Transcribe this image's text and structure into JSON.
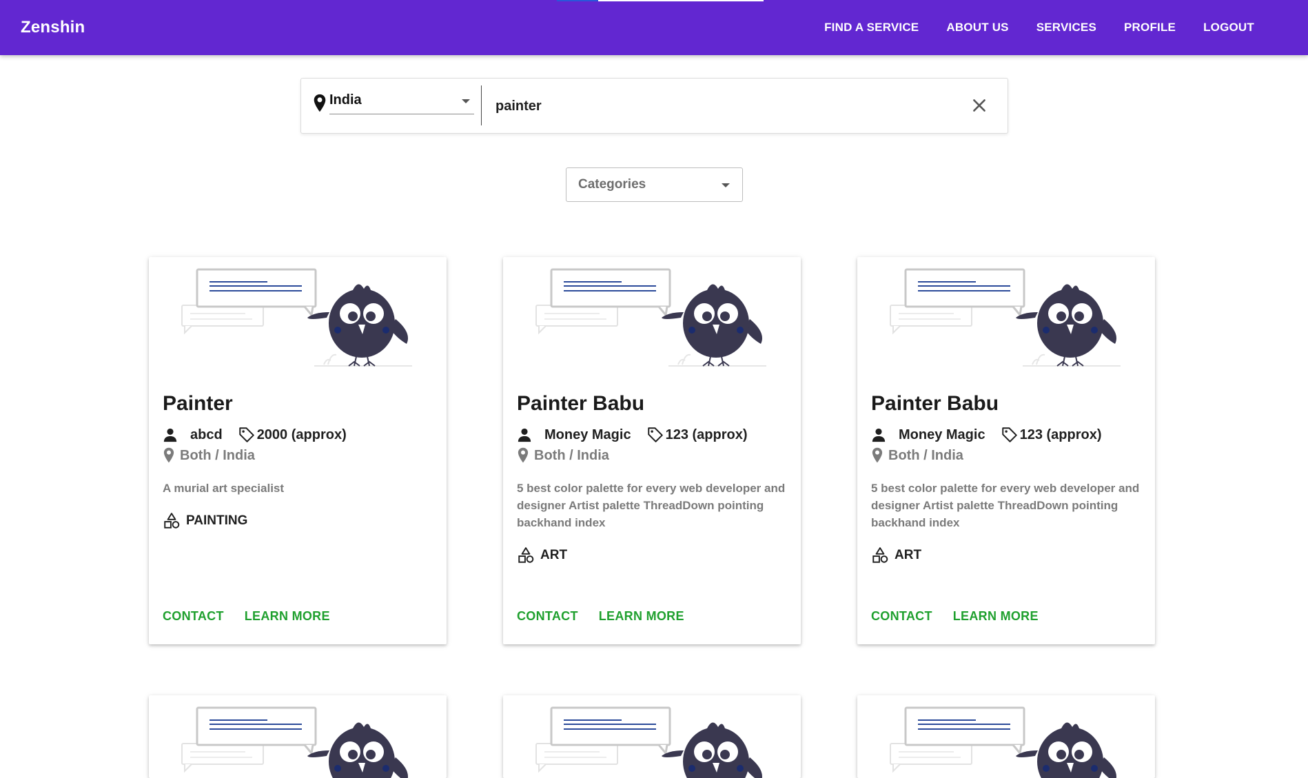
{
  "app": {
    "brand": "Zenshin"
  },
  "nav": {
    "items": [
      "FIND A SERVICE",
      "ABOUT US",
      "SERVICES",
      "PROFILE",
      "LOGOUT"
    ]
  },
  "search": {
    "location": "India",
    "query": "painter"
  },
  "filters": {
    "categories_label": "Categories"
  },
  "colors": {
    "appbar": "#6227d1",
    "action": "#1fa02e",
    "muted_text": "#7a7a7a"
  },
  "cards": [
    {
      "title": "Painter",
      "provider": "abcd",
      "price": "2000 (approx)",
      "location": "Both / India",
      "description": "A murial art specialist",
      "category": "PAINTING",
      "contact_label": "CONTACT",
      "learn_more_label": "LEARN MORE"
    },
    {
      "title": "Painter Babu",
      "provider": "Money Magic",
      "price": "123 (approx)",
      "location": "Both / India",
      "description": "5 best color palette for every web developer and designer Artist palette ThreadDown pointing backhand index",
      "category": "ART",
      "contact_label": "CONTACT",
      "learn_more_label": "LEARN MORE"
    },
    {
      "title": "Painter Babu",
      "provider": "Money Magic",
      "price": "123 (approx)",
      "location": "Both / India",
      "description": "5 best color palette for every web developer and designer Artist palette ThreadDown pointing backhand index",
      "category": "ART",
      "contact_label": "CONTACT",
      "learn_more_label": "LEARN MORE"
    }
  ],
  "icons": {
    "location": "location-pin-icon",
    "clear": "close-icon",
    "provider": "person-icon",
    "price": "price-tag-icon",
    "category": "category-shapes-icon",
    "illustration": "bird-speech-bubble-illustration"
  }
}
